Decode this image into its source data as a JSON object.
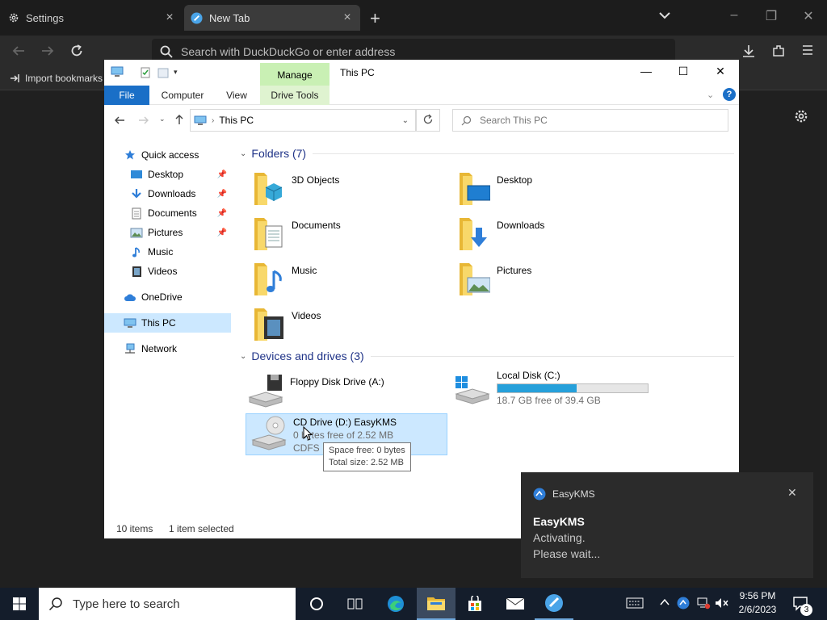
{
  "browser": {
    "tabs": [
      {
        "label": "Settings",
        "icon": "gear-icon"
      },
      {
        "label": "New Tab",
        "icon": "duckduckgo-icon"
      }
    ],
    "address_placeholder": "Search with DuckDuckGo or enter address",
    "bookmarks": {
      "import_label": "Import bookmarks"
    }
  },
  "explorer": {
    "title": "This PC",
    "ribbon": {
      "context_group": "Manage",
      "tabs": [
        "File",
        "Computer",
        "View",
        "Drive Tools"
      ]
    },
    "path": "This PC",
    "search_placeholder": "Search This PC",
    "nav": {
      "quick_access": "Quick access",
      "quick_items": [
        {
          "label": "Desktop",
          "icon": "desktop-icon"
        },
        {
          "label": "Downloads",
          "icon": "downloads-icon"
        },
        {
          "label": "Documents",
          "icon": "documents-icon"
        },
        {
          "label": "Pictures",
          "icon": "pictures-icon"
        },
        {
          "label": "Music",
          "icon": "music-icon"
        },
        {
          "label": "Videos",
          "icon": "videos-icon"
        }
      ],
      "onedrive": "OneDrive",
      "this_pc": "This PC",
      "network": "Network"
    },
    "folders_header": "Folders (7)",
    "folders": [
      {
        "label": "3D Objects",
        "icon": "3d-objects-folder-icon"
      },
      {
        "label": "Desktop",
        "icon": "desktop-folder-icon"
      },
      {
        "label": "Documents",
        "icon": "documents-folder-icon"
      },
      {
        "label": "Downloads",
        "icon": "downloads-folder-icon"
      },
      {
        "label": "Music",
        "icon": "music-folder-icon"
      },
      {
        "label": "Pictures",
        "icon": "pictures-folder-icon"
      },
      {
        "label": "Videos",
        "icon": "videos-folder-icon"
      }
    ],
    "drives_header": "Devices and drives (3)",
    "drives": [
      {
        "label": "Floppy Disk Drive (A:)"
      },
      {
        "label": "Local Disk (C:)",
        "free": "18.7 GB free of 39.4 GB",
        "used_fraction": 0.525
      },
      {
        "label": "CD Drive (D:) EasyKMS",
        "free": "0 bytes free of 2.52 MB",
        "fs": "CDFS"
      }
    ],
    "tooltip": {
      "line1": "Space free: 0 bytes",
      "line2": "Total size: 2.52 MB"
    },
    "status": {
      "items": "10 items",
      "selected": "1 item selected"
    }
  },
  "toast": {
    "app": "EasyKMS",
    "title": "EasyKMS",
    "line1": "Activating.",
    "line2": "Please wait..."
  },
  "taskbar": {
    "search_placeholder": "Type here to search",
    "time": "9:56 PM",
    "date": "2/6/2023",
    "notifications": "3"
  },
  "colors": {
    "accent": "#1a6fc7",
    "selection": "#cce8ff",
    "manage": "#c9f0b4",
    "progress": "#26a0da"
  }
}
